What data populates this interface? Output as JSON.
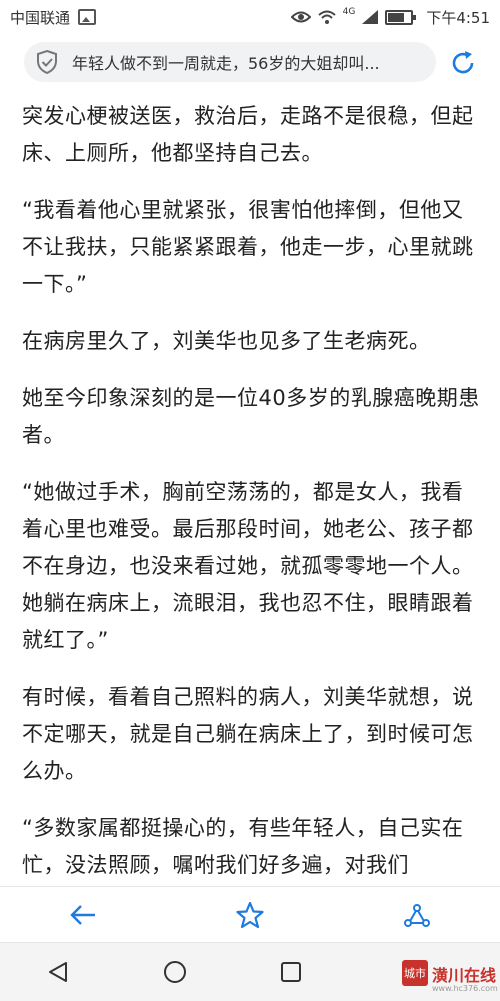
{
  "status_bar": {
    "carrier": "中国联通",
    "signal_label": "4G",
    "time": "下午4:51"
  },
  "url_bar": {
    "title": "年轻人做不到一周就走，56岁的大姐却叫...",
    "shield_icon": "shield-check-icon",
    "refresh_icon": "refresh-icon"
  },
  "article": {
    "paragraphs": [
      "突发心梗被送医，救治后，走路不是很稳，但起床、上厕所，他都坚持自己去。",
      "“我看着他心里就紧张，很害怕他摔倒，但他又不让我扶，只能紧紧跟着，他走一步，心里就跳一下。”",
      "在病房里久了，刘美华也见多了生老病死。",
      "她至今印象深刻的是一位40多岁的乳腺癌晚期患者。",
      "“她做过手术，胸前空荡荡的，都是女人，我看着心里也难受。最后那段时间，她老公、孩子都不在身边，也没来看过她，就孤零零地一个人。她躺在病床上，流眼泪，我也忍不住，眼睛跟着就红了。”",
      "有时候，看着自己照料的病人，刘美华就想，说不定哪天，就是自己躺在病床上了，到时候可怎么办。",
      "“多数家属都挺操心的，有些年轻人，自己实在忙，没法照顾，嘱咐我们好多遍，对我们"
    ]
  },
  "toolbar": {
    "back_icon": "arrow-left-icon",
    "favorite_icon": "star-icon",
    "share_icon": "share-icon"
  },
  "watermark": {
    "logo_text": "城市",
    "name": "潢川在线",
    "site": "www.hc376.com"
  },
  "colors": {
    "accent": "#1f7ae0",
    "icon_gray": "#555555",
    "watermark_red": "#c8322c"
  }
}
